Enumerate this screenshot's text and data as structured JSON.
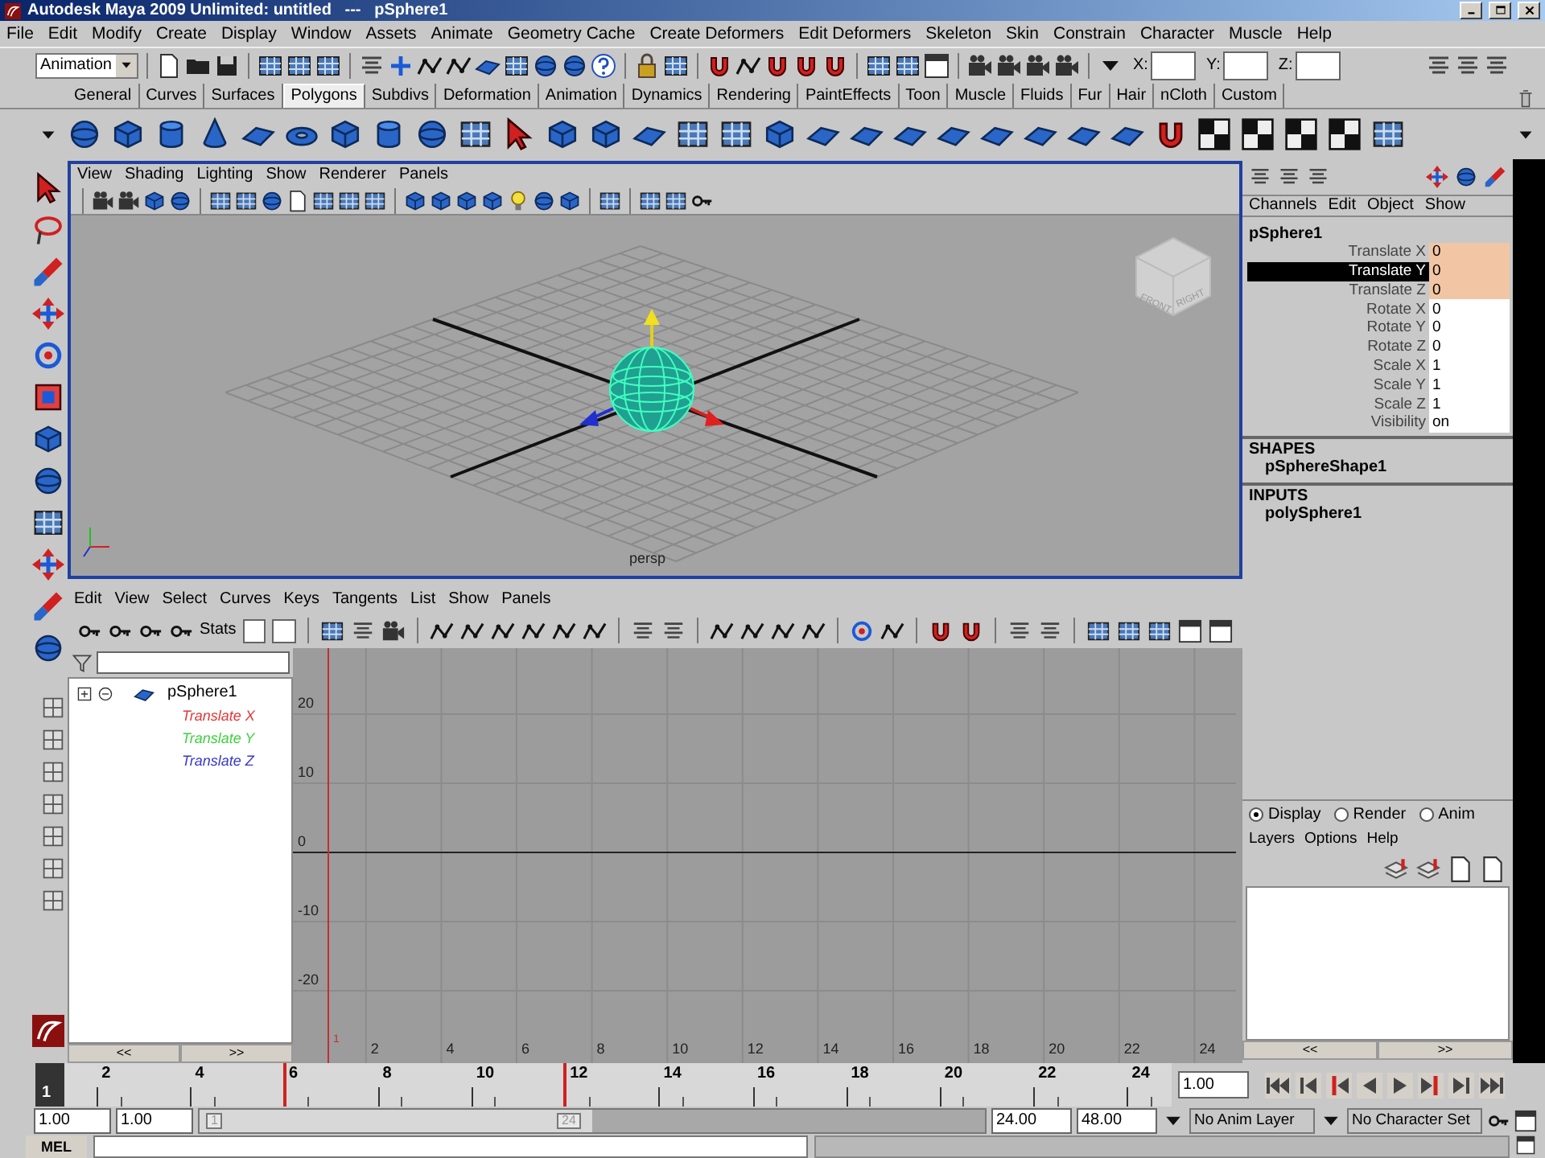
{
  "window": {
    "title": "Autodesk Maya 2009 Unlimited: untitled   ---   pSphere1"
  },
  "menu_bar": [
    "File",
    "Edit",
    "Modify",
    "Create",
    "Display",
    "Window",
    "Assets",
    "Animate",
    "Geometry Cache",
    "Create Deformers",
    "Edit Deformers",
    "Skeleton",
    "Skin",
    "Constrain",
    "Character",
    "Muscle",
    "Help"
  ],
  "status_line": {
    "menu_set": "Animation",
    "fields": [
      {
        "label": "X:"
      },
      {
        "label": "Y:"
      },
      {
        "label": "Z:"
      }
    ]
  },
  "shelf_tabs": [
    {
      "label": "General",
      "selected": false
    },
    {
      "label": "Curves",
      "selected": false
    },
    {
      "label": "Surfaces",
      "selected": false
    },
    {
      "label": "Polygons",
      "selected": true
    },
    {
      "label": "Subdivs",
      "selected": false
    },
    {
      "label": "Deformation",
      "selected": false
    },
    {
      "label": "Animation",
      "selected": false
    },
    {
      "label": "Dynamics",
      "selected": false
    },
    {
      "label": "Rendering",
      "selected": false
    },
    {
      "label": "PaintEffects",
      "selected": false
    },
    {
      "label": "Toon",
      "selected": false
    },
    {
      "label": "Muscle",
      "selected": false
    },
    {
      "label": "Fluids",
      "selected": false
    },
    {
      "label": "Fur",
      "selected": false
    },
    {
      "label": "Hair",
      "selected": false
    },
    {
      "label": "nCloth",
      "selected": false
    },
    {
      "label": "Custom",
      "selected": false
    }
  ],
  "viewport": {
    "menu": [
      "View",
      "Shading",
      "Lighting",
      "Show",
      "Renderer",
      "Panels"
    ],
    "active": true,
    "view_cube": [
      "FRONT",
      "RIGHT"
    ],
    "camera": "persp"
  },
  "graph_editor": {
    "menu": [
      "Edit",
      "View",
      "Select",
      "Curves",
      "Keys",
      "Tangents",
      "List",
      "Show",
      "Panels"
    ],
    "stats_label": "Stats",
    "outliner": [
      {
        "label": "pSphere1",
        "children": [
          {
            "label": "Translate X",
            "color": "#e03838"
          },
          {
            "label": "Translate Y",
            "color": "#40d040"
          },
          {
            "label": "Translate Z",
            "color": "#3838c8"
          }
        ]
      }
    ],
    "scroll_buttons": [
      "<<",
      ">>"
    ],
    "y_labels": [
      "20",
      "10",
      "0",
      "-10",
      "-20"
    ],
    "x_labels": [
      "2",
      "4",
      "6",
      "8",
      "10",
      "12",
      "14",
      "16",
      "18",
      "20",
      "22",
      "24"
    ],
    "current_time": "1"
  },
  "channel_box": {
    "menu": [
      "Channels",
      "Edit",
      "Object",
      "Show"
    ],
    "object": "pSphere1",
    "channels": [
      {
        "name": "Translate X",
        "value": "0",
        "keyed": true,
        "selected": false
      },
      {
        "name": "Translate Y",
        "value": "0",
        "keyed": true,
        "selected": true
      },
      {
        "name": "Translate Z",
        "value": "0",
        "keyed": true,
        "selected": false
      },
      {
        "name": "Rotate X",
        "value": "0",
        "keyed": false,
        "selected": false
      },
      {
        "name": "Rotate Y",
        "value": "0",
        "keyed": false,
        "selected": false
      },
      {
        "name": "Rotate Z",
        "value": "0",
        "keyed": false,
        "selected": false
      },
      {
        "name": "Scale X",
        "value": "1",
        "keyed": false,
        "selected": false
      },
      {
        "name": "Scale Y",
        "value": "1",
        "keyed": false,
        "selected": false
      },
      {
        "name": "Scale Z",
        "value": "1",
        "keyed": false,
        "selected": false
      },
      {
        "name": "Visibility",
        "value": "on",
        "keyed": false,
        "selected": false
      }
    ],
    "sections": [
      {
        "heading": "SHAPES",
        "items": [
          "pSphereShape1"
        ]
      },
      {
        "heading": "INPUTS",
        "items": [
          "polySphere1"
        ]
      }
    ]
  },
  "layer_editor": {
    "modes": [
      {
        "label": "Display",
        "selected": true
      },
      {
        "label": "Render",
        "selected": false
      },
      {
        "label": "Anim",
        "selected": false
      }
    ],
    "menu": [
      "Layers",
      "Options",
      "Help"
    ],
    "scroll_buttons": [
      "<<",
      ">>"
    ]
  },
  "time_slider": {
    "current_frame": "1",
    "ticks": [
      {
        "label": "2",
        "key": false
      },
      {
        "label": "4",
        "key": false
      },
      {
        "label": "6",
        "key": true
      },
      {
        "label": "8",
        "key": false
      },
      {
        "label": "10",
        "key": false
      },
      {
        "label": "12",
        "key": true
      },
      {
        "label": "14",
        "key": false
      },
      {
        "label": "16",
        "key": false
      },
      {
        "label": "18",
        "key": false
      },
      {
        "label": "20",
        "key": false
      },
      {
        "label": "22",
        "key": false
      },
      {
        "label": "24",
        "key": false
      }
    ],
    "current_time": "1.00"
  },
  "range_slider": {
    "level": 0.5,
    "start": "1.00",
    "range_start": "1.00",
    "handle_start": "1",
    "handle_end": "24",
    "range_end": "24.00",
    "end": "48.00",
    "anim_layer": "No Anim Layer",
    "character_set": "No Character Set"
  },
  "command_line": {
    "language": "MEL"
  }
}
